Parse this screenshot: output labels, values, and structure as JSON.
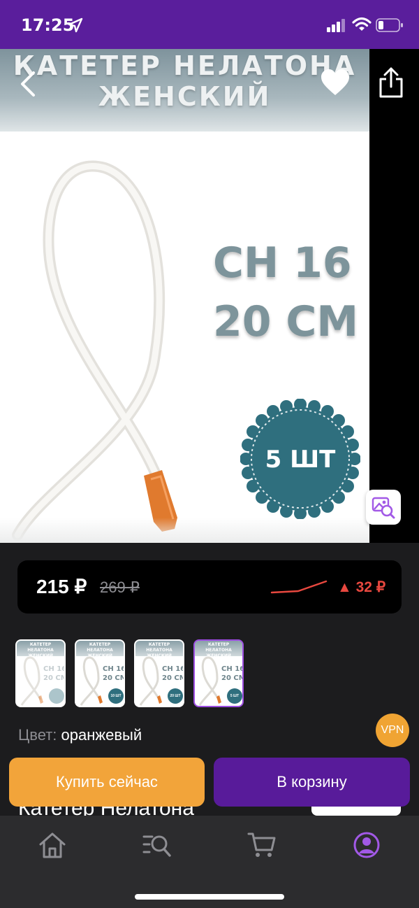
{
  "status_bar": {
    "time": "17:25",
    "bg_color": "#5a1e9c",
    "icons": [
      "location-arrow-icon",
      "cellular-signal-icon",
      "wifi-icon",
      "battery-icon"
    ]
  },
  "hero": {
    "banner_line1": "КАТЕТЕР НЕЛАТОНА",
    "banner_line2": "ЖЕНСКИЙ",
    "spec_line1": "CH 16",
    "spec_line2": "20 СМ",
    "badge_text": "5 ШТ",
    "badge_color": "#2f6f7e",
    "tip_color": "#e07a2e"
  },
  "nav": {
    "back_icon": "chevron-left-icon",
    "favorite_icon": "heart-icon",
    "share_icon": "share-icon",
    "image_search_icon": "image-search-icon"
  },
  "price": {
    "current": "215 ₽",
    "old": "269 ₽",
    "diff": "▲ 32 ₽",
    "diff_color": "#e8483f"
  },
  "thumbnails": [
    {
      "header": "КАТЕТЕР НЕЛАТОНА ЖЕНСКИЙ",
      "spec1": "CH 16",
      "spec2": "20 СМ",
      "badge": "",
      "selected": false
    },
    {
      "header": "КАТЕТЕР НЕЛАТОНА ЖЕНСКИЙ",
      "spec1": "CH 16",
      "spec2": "20 СМ",
      "badge": "10 ШТ",
      "selected": false
    },
    {
      "header": "КАТЕТЕР НЕЛАТОНА ЖЕНСКИЙ",
      "spec1": "CH 16",
      "spec2": "20 СМ",
      "badge": "20 ШТ",
      "selected": false
    },
    {
      "header": "КАТЕТЕР НЕЛАТОНА ЖЕНСКИЙ",
      "spec1": "CH 16",
      "spec2": "20 СМ",
      "badge": "5 ШТ",
      "selected": true
    }
  ],
  "color": {
    "label": "Цвет:",
    "value": "оранжевый"
  },
  "vpn_badge": "VPN",
  "actions": {
    "buy_now": "Купить сейчас",
    "add_to_cart": "В корзину",
    "buy_color": "#f2a43a",
    "cart_color": "#581b9a"
  },
  "product_title_peek": "Катетер Нелатона",
  "tabbar": {
    "items": [
      {
        "icon": "home-icon",
        "active": false
      },
      {
        "icon": "catalog-search-icon",
        "active": false
      },
      {
        "icon": "cart-icon",
        "active": false
      },
      {
        "icon": "profile-icon",
        "active": true
      }
    ],
    "active_color": "#a259e6",
    "inactive_color": "#8e8e93"
  }
}
